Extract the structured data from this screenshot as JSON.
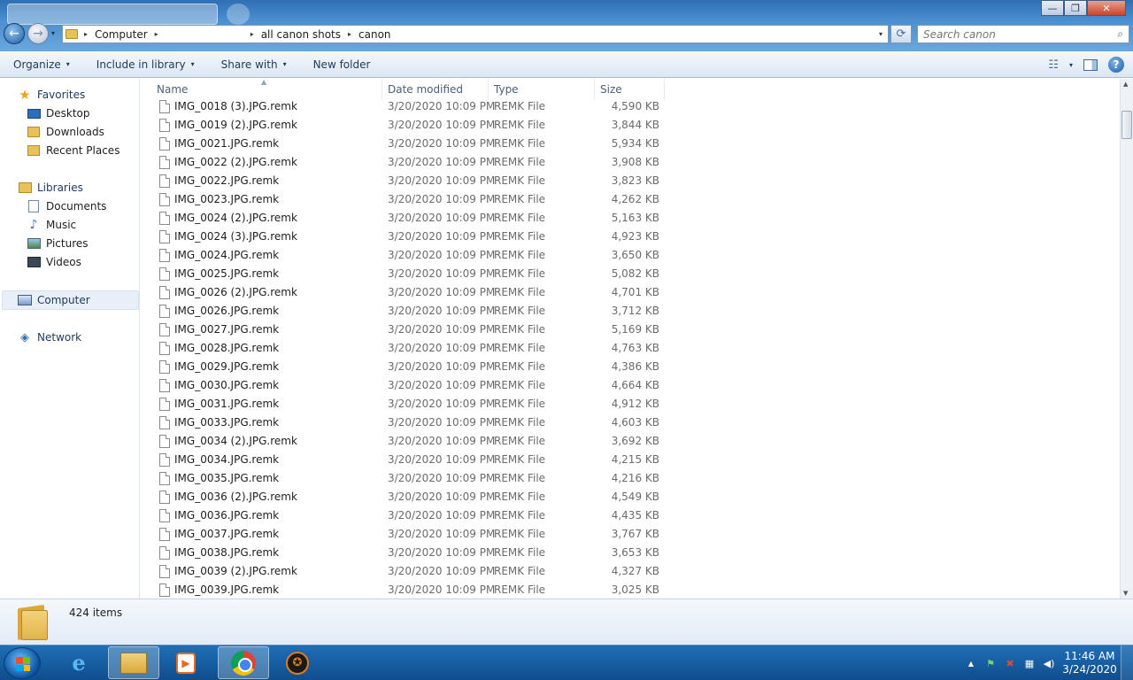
{
  "window": {
    "minimize_glyph": "—",
    "maximize_glyph": "❐",
    "close_glyph": "✕"
  },
  "nav": {
    "back_glyph": "←",
    "forward_glyph": "→",
    "recent_glyph": "▾"
  },
  "address": {
    "crumbs": [
      "Computer",
      "all canon shots",
      "canon"
    ],
    "separator_glyph": "▸",
    "dropdown_glyph": "▾",
    "refresh_glyph": "⟳"
  },
  "search": {
    "placeholder": "Search canon",
    "icon_glyph": "⌕"
  },
  "toolbar": {
    "organize": "Organize",
    "include_in_library": "Include in library",
    "share_with": "Share with",
    "new_folder": "New folder",
    "caret": "▾",
    "view_glyph": "☷",
    "view_caret": "▾",
    "help_glyph": "?"
  },
  "sidebar": {
    "favorites": "Favorites",
    "desktop": "Desktop",
    "downloads": "Downloads",
    "recent_places": "Recent Places",
    "libraries": "Libraries",
    "documents": "Documents",
    "music": "Music",
    "pictures": "Pictures",
    "videos": "Videos",
    "computer": "Computer",
    "network": "Network",
    "star_glyph": "★",
    "music_glyph": "♪",
    "network_glyph": "◈"
  },
  "columns": {
    "name": "Name",
    "date_modified": "Date modified",
    "type": "Type",
    "size": "Size",
    "sort_glyph": "▲"
  },
  "files": [
    {
      "name": "IMG_0018 (3).JPG.remk",
      "date": "3/20/2020 10:09 PM",
      "type": "REMK File",
      "size": "4,590 KB"
    },
    {
      "name": "IMG_0019 (2).JPG.remk",
      "date": "3/20/2020 10:09 PM",
      "type": "REMK File",
      "size": "3,844 KB"
    },
    {
      "name": "IMG_0021.JPG.remk",
      "date": "3/20/2020 10:09 PM",
      "type": "REMK File",
      "size": "5,934 KB"
    },
    {
      "name": "IMG_0022 (2).JPG.remk",
      "date": "3/20/2020 10:09 PM",
      "type": "REMK File",
      "size": "3,908 KB"
    },
    {
      "name": "IMG_0022.JPG.remk",
      "date": "3/20/2020 10:09 PM",
      "type": "REMK File",
      "size": "3,823 KB"
    },
    {
      "name": "IMG_0023.JPG.remk",
      "date": "3/20/2020 10:09 PM",
      "type": "REMK File",
      "size": "4,262 KB"
    },
    {
      "name": "IMG_0024 (2).JPG.remk",
      "date": "3/20/2020 10:09 PM",
      "type": "REMK File",
      "size": "5,163 KB"
    },
    {
      "name": "IMG_0024 (3).JPG.remk",
      "date": "3/20/2020 10:09 PM",
      "type": "REMK File",
      "size": "4,923 KB"
    },
    {
      "name": "IMG_0024.JPG.remk",
      "date": "3/20/2020 10:09 PM",
      "type": "REMK File",
      "size": "3,650 KB"
    },
    {
      "name": "IMG_0025.JPG.remk",
      "date": "3/20/2020 10:09 PM",
      "type": "REMK File",
      "size": "5,082 KB"
    },
    {
      "name": "IMG_0026 (2).JPG.remk",
      "date": "3/20/2020 10:09 PM",
      "type": "REMK File",
      "size": "4,701 KB"
    },
    {
      "name": "IMG_0026.JPG.remk",
      "date": "3/20/2020 10:09 PM",
      "type": "REMK File",
      "size": "3,712 KB"
    },
    {
      "name": "IMG_0027.JPG.remk",
      "date": "3/20/2020 10:09 PM",
      "type": "REMK File",
      "size": "5,169 KB"
    },
    {
      "name": "IMG_0028.JPG.remk",
      "date": "3/20/2020 10:09 PM",
      "type": "REMK File",
      "size": "4,763 KB"
    },
    {
      "name": "IMG_0029.JPG.remk",
      "date": "3/20/2020 10:09 PM",
      "type": "REMK File",
      "size": "4,386 KB"
    },
    {
      "name": "IMG_0030.JPG.remk",
      "date": "3/20/2020 10:09 PM",
      "type": "REMK File",
      "size": "4,664 KB"
    },
    {
      "name": "IMG_0031.JPG.remk",
      "date": "3/20/2020 10:09 PM",
      "type": "REMK File",
      "size": "4,912 KB"
    },
    {
      "name": "IMG_0033.JPG.remk",
      "date": "3/20/2020 10:09 PM",
      "type": "REMK File",
      "size": "4,603 KB"
    },
    {
      "name": "IMG_0034 (2).JPG.remk",
      "date": "3/20/2020 10:09 PM",
      "type": "REMK File",
      "size": "3,692 KB"
    },
    {
      "name": "IMG_0034.JPG.remk",
      "date": "3/20/2020 10:09 PM",
      "type": "REMK File",
      "size": "4,215 KB"
    },
    {
      "name": "IMG_0035.JPG.remk",
      "date": "3/20/2020 10:09 PM",
      "type": "REMK File",
      "size": "4,216 KB"
    },
    {
      "name": "IMG_0036 (2).JPG.remk",
      "date": "3/20/2020 10:09 PM",
      "type": "REMK File",
      "size": "4,549 KB"
    },
    {
      "name": "IMG_0036.JPG.remk",
      "date": "3/20/2020 10:09 PM",
      "type": "REMK File",
      "size": "4,435 KB"
    },
    {
      "name": "IMG_0037.JPG.remk",
      "date": "3/20/2020 10:09 PM",
      "type": "REMK File",
      "size": "3,767 KB"
    },
    {
      "name": "IMG_0038.JPG.remk",
      "date": "3/20/2020 10:09 PM",
      "type": "REMK File",
      "size": "3,653 KB"
    },
    {
      "name": "IMG_0039 (2).JPG.remk",
      "date": "3/20/2020 10:09 PM",
      "type": "REMK File",
      "size": "4,327 KB"
    },
    {
      "name": "IMG_0039.JPG.remk",
      "date": "3/20/2020 10:09 PM",
      "type": "REMK File",
      "size": "3,025 KB"
    }
  ],
  "scrollbar": {
    "up_glyph": "▲",
    "down_glyph": "▼"
  },
  "details": {
    "item_count": "424 items"
  },
  "taskbar": {
    "ie_glyph": "e",
    "media_glyph": "▶",
    "app_glyph": "✪",
    "tray_up_glyph": "▲",
    "tray_flag_glyph": "⚑",
    "tray_action_glyph": "✖",
    "tray_network_glyph": "▦",
    "tray_volume_glyph": "◀)",
    "time": "11:46 AM",
    "date": "3/24/2020"
  },
  "colors": {
    "title_gradient_top": "#2f6fb3",
    "taskbar": "#1f6fb7",
    "accent": "#1e395b"
  }
}
